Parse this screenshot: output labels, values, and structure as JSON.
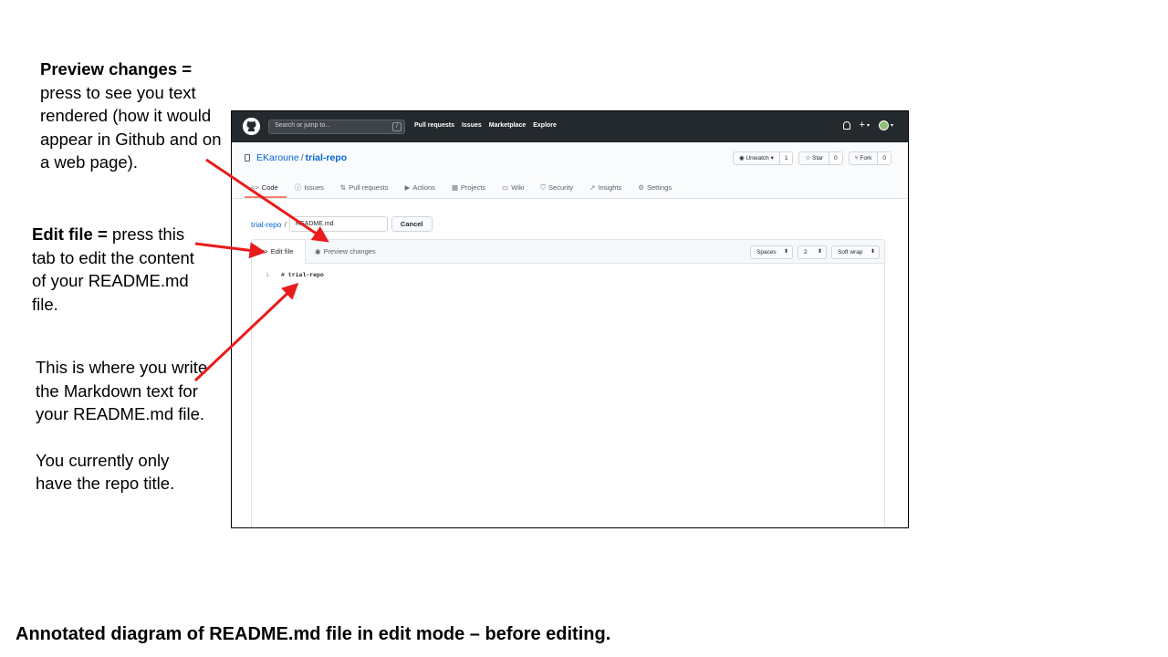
{
  "annotations": {
    "preview": {
      "label": "Preview changes =",
      "text": "press to see you text rendered (how it would appear in Github and on a web page)."
    },
    "edit": {
      "label": "Edit file =",
      "text": "press this tab to edit the content of your README.md file."
    },
    "write": {
      "line1": "This is where you write the Markdown text for your README.md file.",
      "line2": "You currently only have the repo title."
    },
    "caption": "Annotated diagram of README.md file in edit mode – before editing.",
    "arrow_color": "#e81c1c"
  },
  "header": {
    "search_placeholder": "Search or jump to...",
    "search_key": "/",
    "nav": [
      "Pull requests",
      "Issues",
      "Marketplace",
      "Explore"
    ],
    "plus": "+",
    "bg_color": "#24292e"
  },
  "repo": {
    "owner": "EKaroune",
    "separator": "/",
    "name": "trial-repo",
    "watch_label": "Unwatch ▾",
    "watch_count": "1",
    "star_label": "Star",
    "star_count": "0",
    "fork_label": "Fork",
    "fork_count": "0",
    "tabs": [
      {
        "icon": "<>",
        "label": "Code"
      },
      {
        "icon": "ⓘ",
        "label": "Issues"
      },
      {
        "icon": "⇅",
        "label": "Pull requests"
      },
      {
        "icon": "▶",
        "label": "Actions"
      },
      {
        "icon": "▦",
        "label": "Projects"
      },
      {
        "icon": "▭",
        "label": "Wiki"
      },
      {
        "icon": "⛉",
        "label": "Security"
      },
      {
        "icon": "↗",
        "label": "Insights"
      },
      {
        "icon": "⚙",
        "label": "Settings"
      }
    ]
  },
  "editor": {
    "path_repo": "trial-repo",
    "path_sep": "/",
    "filename": "README.md",
    "cancel_label": "Cancel",
    "tab_edit_icon": "<>",
    "tab_edit": "Edit file",
    "tab_preview_icon": "◉",
    "tab_preview": "Preview changes",
    "indent_mode": "Spaces",
    "indent_size": "2",
    "wrap_mode": "Soft wrap",
    "line_number": "1",
    "line_text": "# trial-repo"
  }
}
